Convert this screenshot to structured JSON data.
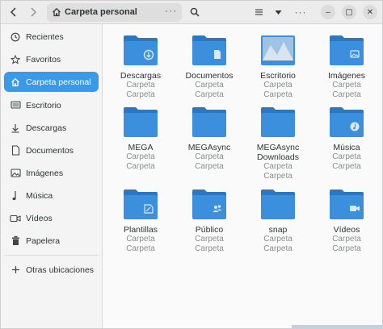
{
  "header": {
    "back_icon": "chevron-left",
    "forward_icon": "chevron-right",
    "location_label": "Carpeta personal",
    "location_menu": "···",
    "search_icon": "search",
    "view_icon": "list",
    "sort_icon": "triangle-down",
    "menu_label": "···",
    "minimize_label": "–",
    "maximize_label": "▢",
    "close_label": "✕"
  },
  "sidebar": {
    "items": [
      {
        "label": "Recientes",
        "icon": "clock-icon"
      },
      {
        "label": "Favoritos",
        "icon": "star-icon"
      },
      {
        "label": "Carpeta personal",
        "icon": "home-icon",
        "active": true
      },
      {
        "label": "Escritorio",
        "icon": "desktop-icon"
      },
      {
        "label": "Descargas",
        "icon": "download-icon"
      },
      {
        "label": "Documentos",
        "icon": "document-icon"
      },
      {
        "label": "Imágenes",
        "icon": "image-icon"
      },
      {
        "label": "Música",
        "icon": "music-icon"
      },
      {
        "label": "Vídeos",
        "icon": "video-icon"
      },
      {
        "label": "Papelera",
        "icon": "trash-icon"
      }
    ],
    "other_locations": {
      "label": "Otras ubicaciones",
      "icon": "plus-icon"
    }
  },
  "folders": [
    {
      "name": "Descargas",
      "sub1": "Carpeta",
      "sub2": "Carpeta",
      "emblem": "download"
    },
    {
      "name": "Documentos",
      "sub1": "Carpeta",
      "sub2": "Carpeta",
      "emblem": "document"
    },
    {
      "name": "Escritorio",
      "sub1": "Carpeta",
      "sub2": "Carpeta",
      "emblem": "desktop"
    },
    {
      "name": "Imágenes",
      "sub1": "Carpeta",
      "sub2": "Carpeta",
      "emblem": "image"
    },
    {
      "name": "MEGA",
      "sub1": "Carpeta",
      "sub2": "Carpeta",
      "emblem": "none"
    },
    {
      "name": "MEGAsync",
      "sub1": "Carpeta",
      "sub2": "Carpeta",
      "emblem": "none"
    },
    {
      "name": "MEGAsync",
      "name2": "Downloads",
      "sub1": "Carpeta",
      "sub2": "Carpeta",
      "emblem": "none"
    },
    {
      "name": "Música",
      "sub1": "Carpeta",
      "sub2": "Carpeta",
      "emblem": "music"
    },
    {
      "name": "Plantillas",
      "sub1": "Carpeta",
      "sub2": "Carpeta",
      "emblem": "template"
    },
    {
      "name": "Público",
      "sub1": "Carpeta",
      "sub2": "Carpeta",
      "emblem": "users"
    },
    {
      "name": "snap",
      "sub1": "Carpeta",
      "sub2": "Carpeta",
      "emblem": "none"
    },
    {
      "name": "Vídeos",
      "sub1": "Carpeta",
      "sub2": "Carpeta",
      "emblem": "video"
    }
  ],
  "colors": {
    "accent": "#3a9ae8",
    "folder_body": "#3b8fdc",
    "folder_tab": "#2b78c2",
    "folder_emblem": "#dbe9f7"
  }
}
